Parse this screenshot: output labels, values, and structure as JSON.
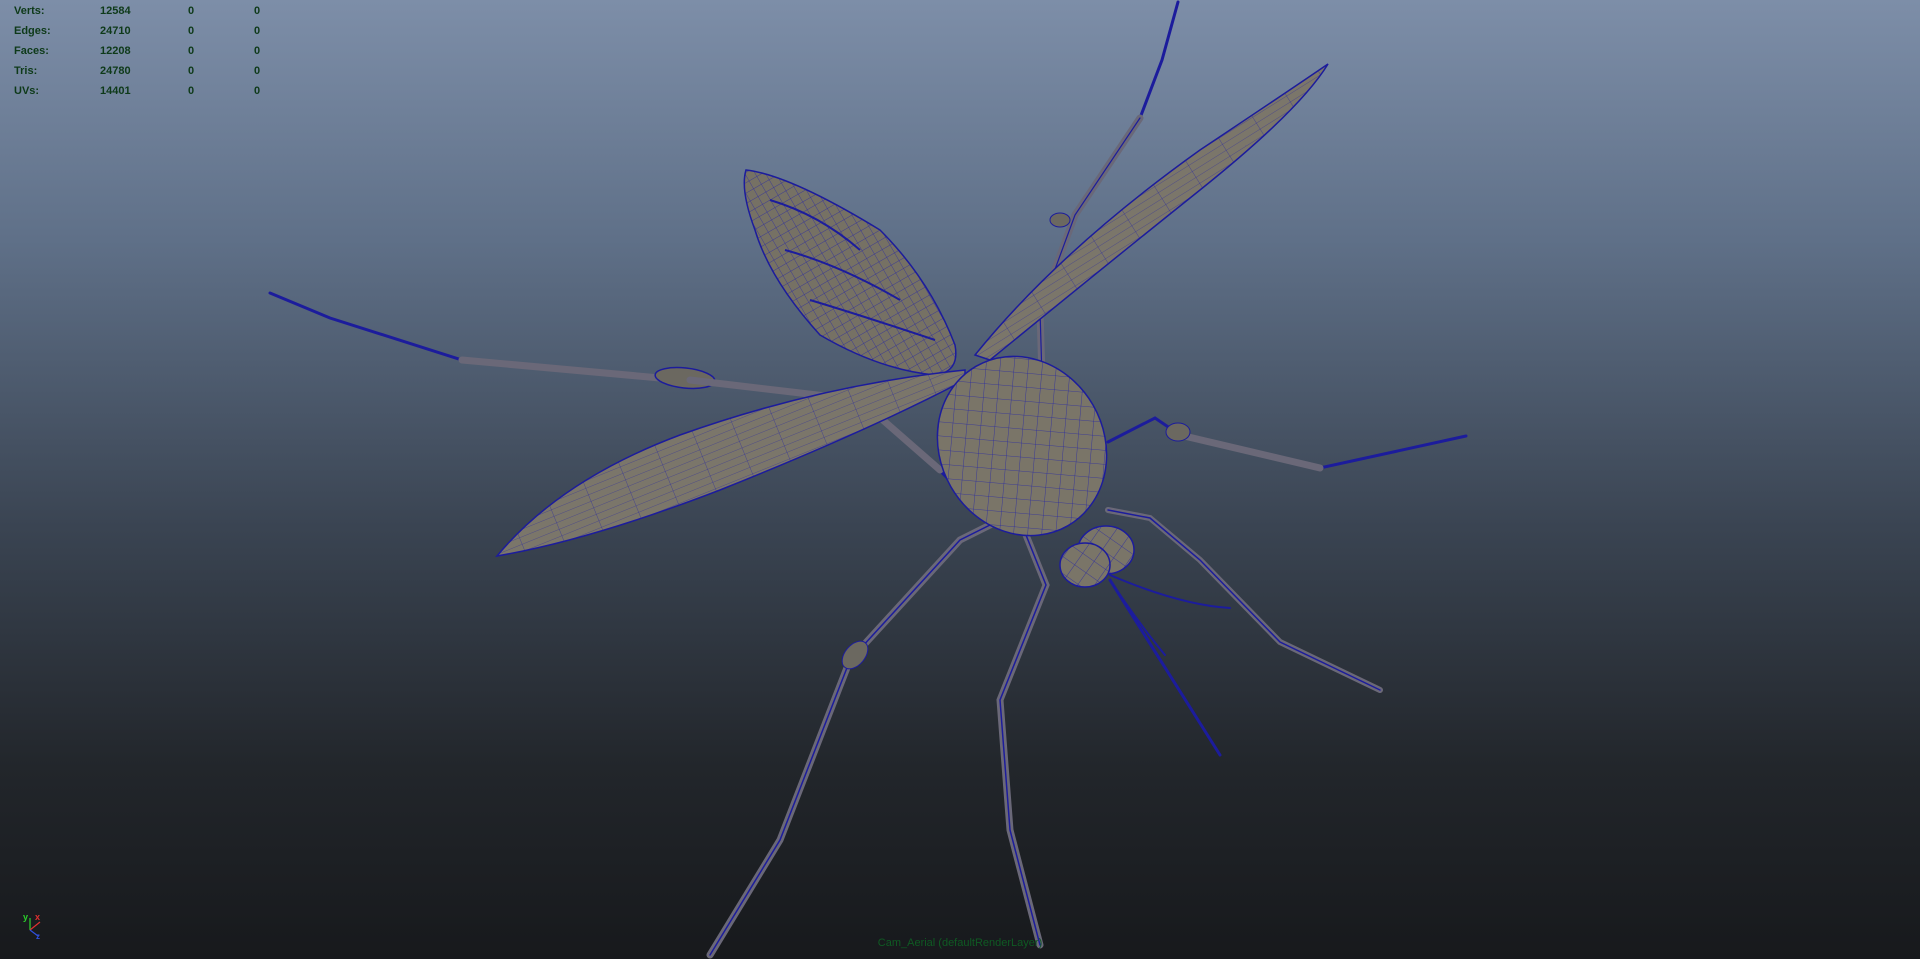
{
  "hud": {
    "stats": [
      {
        "label": "Verts:",
        "v1": "12584",
        "v2": "0",
        "v3": "0"
      },
      {
        "label": "Edges:",
        "v1": "24710",
        "v2": "0",
        "v3": "0"
      },
      {
        "label": "Faces:",
        "v1": "12208",
        "v2": "0",
        "v3": "0"
      },
      {
        "label": "Tris:",
        "v1": "24780",
        "v2": "0",
        "v3": "0"
      },
      {
        "label": "UVs:",
        "v1": "14401",
        "v2": "0",
        "v3": "0"
      }
    ]
  },
  "axis_gizmo": {
    "y_label": "y",
    "x_label": "x",
    "z_label": "z"
  },
  "camera_label": "Cam_Aerial (defaultRenderLayer)",
  "colors": {
    "wireframe": "#1c1c9c",
    "mesh_fill": "#7a7568",
    "hud_text": "#0e3a19"
  }
}
